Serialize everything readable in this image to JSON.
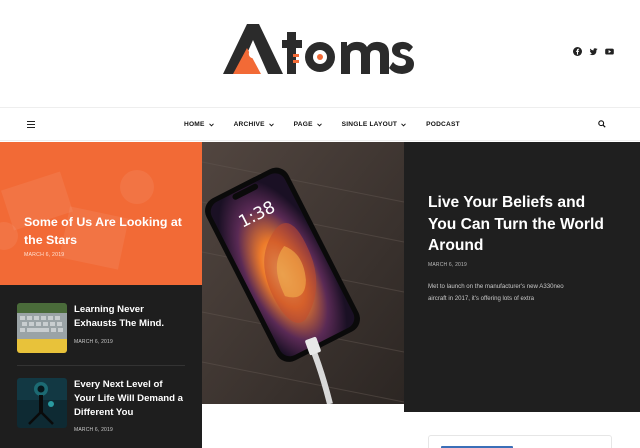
{
  "site": {
    "logo_text": "Atoms",
    "accent": "#f26a36",
    "dark": "#1f1f1f"
  },
  "social": [
    {
      "icon": "facebook-icon"
    },
    {
      "icon": "twitter-icon"
    },
    {
      "icon": "youtube-icon"
    }
  ],
  "nav": {
    "items": [
      {
        "label": "HOME",
        "dropdown": true
      },
      {
        "label": "ARCHIVE",
        "dropdown": true
      },
      {
        "label": "PAGE",
        "dropdown": true
      },
      {
        "label": "SINGLE LAYOUT",
        "dropdown": true
      },
      {
        "label": "PODCAST",
        "dropdown": false
      }
    ]
  },
  "featured": {
    "title": "Some of Us Are Looking at the Stars",
    "date": "MARCH 6, 2019"
  },
  "side_posts": [
    {
      "title": "Learning Never Exhausts The Mind.",
      "date": "MARCH 6, 2019"
    },
    {
      "title": "Every Next Level of Your Life Will Demand a Different You",
      "date": "MARCH 6, 2019"
    }
  ],
  "hero": {
    "title": "Live Your Beliefs and You Can Turn the World Around",
    "date": "MARCH 6, 2019",
    "excerpt": "Met to launch on the manufacturer's new A330neo aircraft in 2017, it's offering lots of extra",
    "phone_time": "1:38"
  }
}
